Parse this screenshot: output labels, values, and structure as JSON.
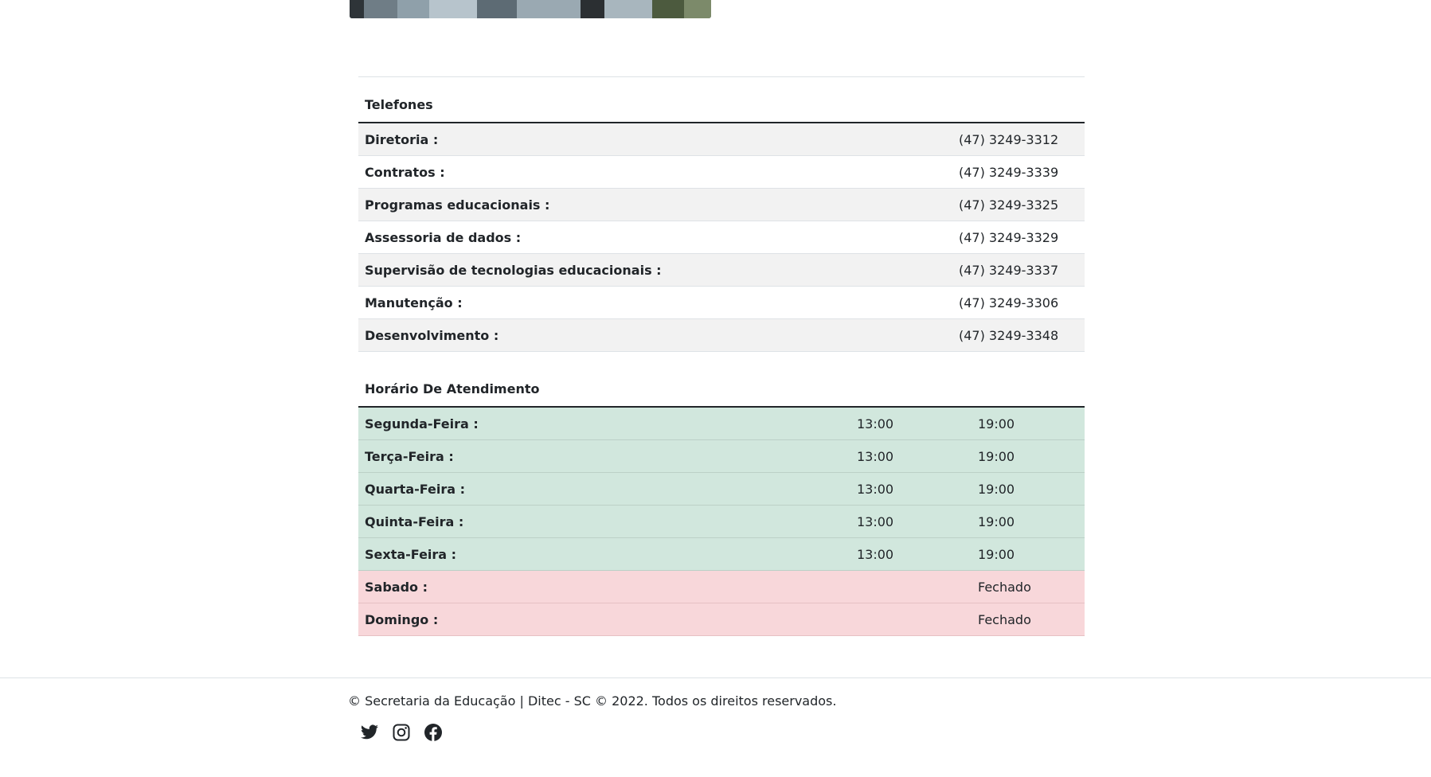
{
  "phones": {
    "title": "Telefones",
    "rows": [
      {
        "label": "Diretoria :",
        "value": "(47) 3249-3312"
      },
      {
        "label": "Contratos :",
        "value": "(47) 3249-3339"
      },
      {
        "label": "Programas educacionais :",
        "value": "(47) 3249-3325"
      },
      {
        "label": "Assessoria de dados :",
        "value": "(47) 3249-3329"
      },
      {
        "label": "Supervisão de tecnologias educacionais :",
        "value": "(47) 3249-3337"
      },
      {
        "label": "Manutenção :",
        "value": "(47) 3249-3306"
      },
      {
        "label": "Desenvolvimento :",
        "value": "(47) 3249-3348"
      }
    ]
  },
  "hours": {
    "title": "Horário De Atendimento",
    "rows": [
      {
        "day": "Segunda-Feira :",
        "open": "13:00",
        "close": "19:00",
        "status": "open"
      },
      {
        "day": "Terça-Feira :",
        "open": "13:00",
        "close": "19:00",
        "status": "open"
      },
      {
        "day": "Quarta-Feira :",
        "open": "13:00",
        "close": "19:00",
        "status": "open"
      },
      {
        "day": "Quinta-Feira :",
        "open": "13:00",
        "close": "19:00",
        "status": "open"
      },
      {
        "day": "Sexta-Feira :",
        "open": "13:00",
        "close": "19:00",
        "status": "open"
      },
      {
        "day": "Sabado :",
        "open": "",
        "close": "Fechado",
        "status": "closed"
      },
      {
        "day": "Domingo :",
        "open": "",
        "close": "Fechado",
        "status": "closed"
      }
    ]
  },
  "footer": {
    "copyright": "© Secretaria da Educação | Ditec - SC © 2022. Todos os direitos reservados.",
    "social": [
      "twitter-icon",
      "instagram-icon",
      "facebook-icon"
    ]
  },
  "colors": {
    "open_row": "#d1e7dd",
    "closed_row": "#f8d7da",
    "striped_row": "#f2f2f2",
    "text": "#212529"
  }
}
